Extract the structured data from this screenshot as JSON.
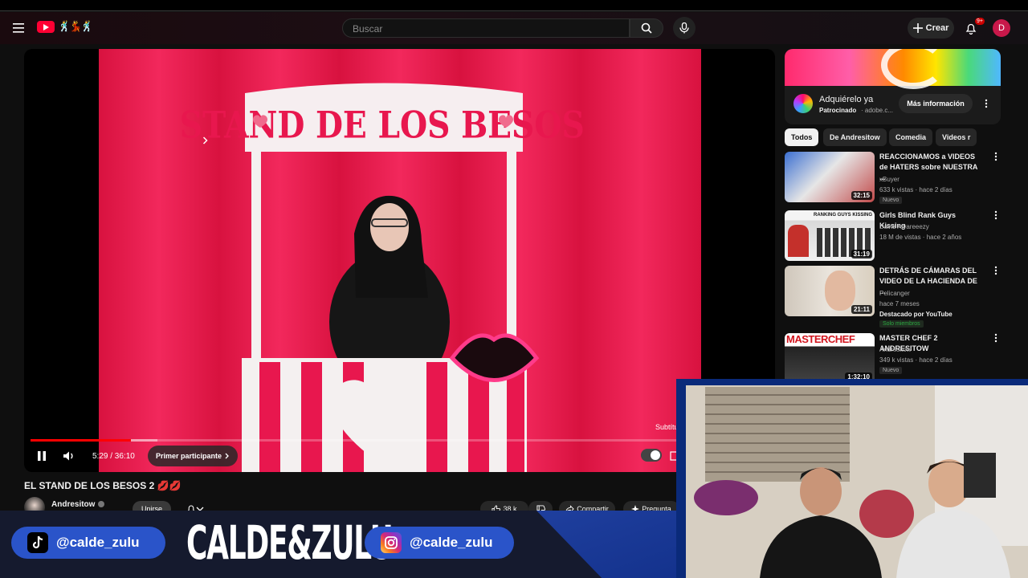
{
  "header": {
    "search_placeholder": "Buscar",
    "create_label": "Crear",
    "notification_count": "9+",
    "avatar_initial": "D",
    "doodle": "🕺💃🕺"
  },
  "player": {
    "subtitles_label": "Subtítulos",
    "current_time": "5:29",
    "duration": "36:10",
    "time_display": "5:29 / 36:10",
    "progress_fraction": 0.15,
    "buffered_fraction": 0.19,
    "chapter_label": "Primer participante",
    "booth_sign": "STAND DE LOS BESOS"
  },
  "video": {
    "title": "EL STAND DE LOS BESOS 2 💋💋",
    "channel": "Andresitow",
    "join_label": "Unirse",
    "like_count": "38 k",
    "share_label": "Compartir",
    "more_label": "Pregunta"
  },
  "ad": {
    "title": "Adquiérelo ya",
    "sponsored": "Patrocinado",
    "domain": "· adobe.c...",
    "cta_label": "Más información"
  },
  "chips": [
    "Todos",
    "De Andresitow",
    "Comedia",
    "Videos r"
  ],
  "recommendations": [
    {
      "title": "REACCIONAMOS a VIDEOS de HATERS sobre NUESTRA ...",
      "channel": "xBuyer",
      "meta": "633 k vistas · hace 2 días",
      "badge": "Nuevo",
      "duration": "32:15"
    },
    {
      "title": "Girls Blind Rank Guys Kissing",
      "channel": "David Alvareeezy",
      "meta": "18 M de vistas · hace 2 años",
      "duration": "31:19",
      "thumb_text": "RANKING GUYS KISSING"
    },
    {
      "title": "DETRÁS DE CÁMARAS DEL VIDEO DE LA HACIENDA DE ...",
      "channel": "Pelicanger",
      "meta": "hace 7 meses",
      "featured": "Destacado por YouTube",
      "members": "Solo miembros",
      "duration": "21:11"
    },
    {
      "title": "MASTER CHEF 2 ANDRESITOW",
      "channel": "Andresitow",
      "meta": "349 k vistas · hace 2 días",
      "badge": "Nuevo",
      "duration": "1:32:10",
      "thumb_text": "MASTERCHEF"
    }
  ],
  "overlay": {
    "tiktok_handle": "@calde_zulu",
    "instagram_handle": "@calde_zulu",
    "brand": "CALDE&ZULU"
  },
  "colors": {
    "accent_red": "#ff0000",
    "youtube_red": "#ff0033",
    "overlay_blue": "#2a54c9",
    "curtain_pink": "#e8174e"
  }
}
